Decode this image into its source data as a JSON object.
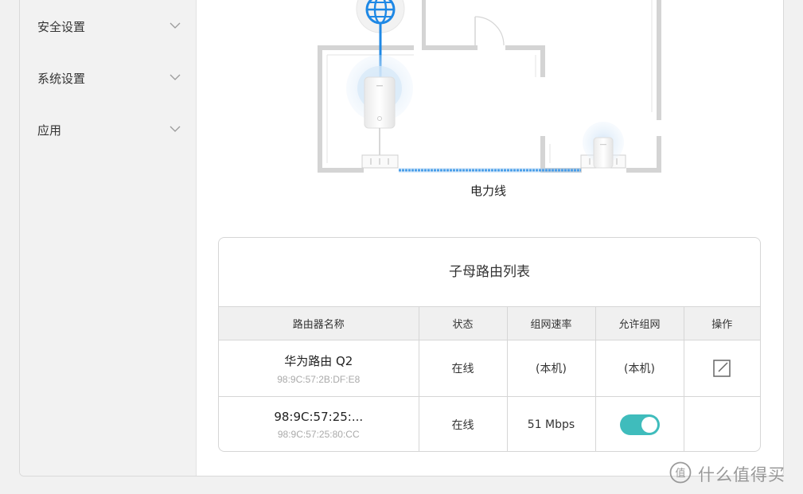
{
  "sidebar": {
    "items": [
      {
        "label": "安全设置"
      },
      {
        "label": "系统设置"
      },
      {
        "label": "应用"
      }
    ]
  },
  "diagram": {
    "powerline_label": "电力线",
    "icons": [
      "globe-icon",
      "router-main",
      "router-sub",
      "power-outlet"
    ],
    "link_color": "#1e88e5"
  },
  "router_list": {
    "title": "子母路由列表",
    "columns": [
      "路由器名称",
      "状态",
      "组网速率",
      "允许组网",
      "操作"
    ],
    "rows": [
      {
        "name": "华为路由 Q2",
        "mac": "98:9C:57:2B:DF:E8",
        "status": "在线",
        "rate": "(本机)",
        "allow": "(本机)",
        "action_icon": "edit-icon"
      },
      {
        "name": "98:9C:57:25:...",
        "mac": "98:9C:57:25:80:CC",
        "status": "在线",
        "rate": "51 Mbps",
        "allow_toggle": "on",
        "action_icon": ""
      }
    ],
    "toggle_color": "#3fbcbc"
  },
  "watermark": {
    "text": "什么值得买",
    "logo_char": "值"
  }
}
